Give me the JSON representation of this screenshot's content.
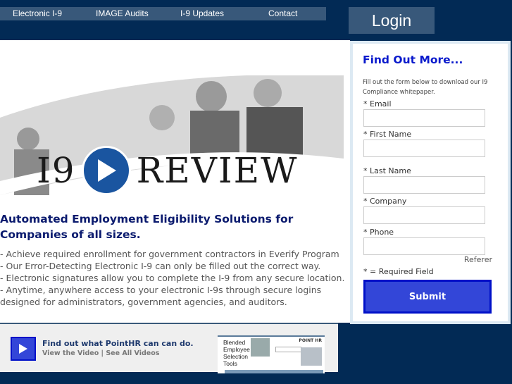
{
  "nav": {
    "items": [
      {
        "label": "Electronic I-9"
      },
      {
        "label": "IMAGE Audits"
      },
      {
        "label": "I-9 Updates"
      },
      {
        "label": "Contact"
      }
    ],
    "login": "Login"
  },
  "banner": {
    "logo_left": "I9",
    "logo_right": "REVIEW"
  },
  "main": {
    "headline": "Automated Employment Eligibility Solutions for Companies of all sizes.",
    "bullets": [
      "- Achieve required enrollment for government contractors in Everify Program",
      "- Our Error-Detecting Electronic I-9 can only be filled out the correct way.",
      "- Electronic signatures allow you to complete the I-9 from any secure location.",
      "- Anytime, anywhere access to your electronic I-9s through secure logins designed for administrators, government agencies, and auditors."
    ]
  },
  "form": {
    "title": "Find Out More...",
    "description": "Fill out the form below to download our I9 Compliance whitepaper.",
    "fields": [
      {
        "label": "* Email",
        "value": ""
      },
      {
        "label": "* First Name",
        "value": ""
      },
      {
        "label": "* Last Name",
        "value": ""
      },
      {
        "label": "* Company",
        "value": ""
      },
      {
        "label": "* Phone",
        "value": ""
      }
    ],
    "referer": "Referer",
    "required_note": "* = Required Field",
    "submit": "Submit"
  },
  "video": {
    "title": "Find out what PointHR can can do.",
    "view_link": "View the Video",
    "separator": " | ",
    "all_link": "See All Videos",
    "thumb": {
      "brand": "POINT HR",
      "lines": [
        "Blended",
        "Employee",
        "Selection",
        "Tools"
      ]
    }
  },
  "colors": {
    "navy": "#022a55",
    "nav": "#38587a",
    "accent": "#3346d8",
    "title": "#0a1acc"
  }
}
